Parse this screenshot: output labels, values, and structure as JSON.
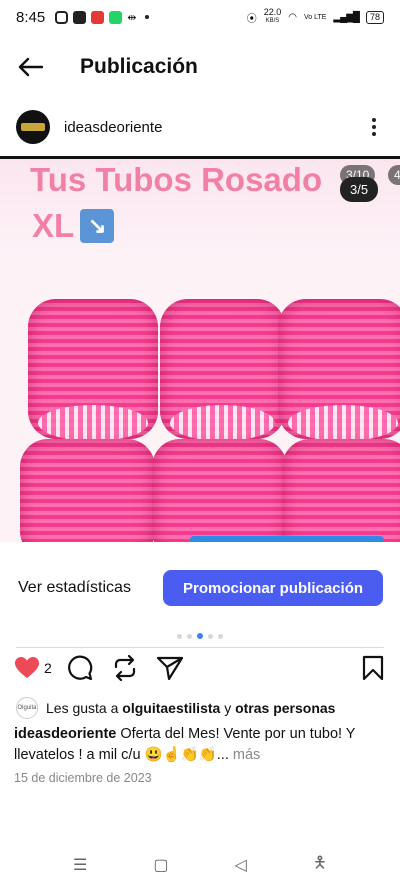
{
  "status_bar": {
    "time": "8:45",
    "app_icons": [
      "instagram-icon",
      "youtube-icon",
      "fs-icon",
      "whatsapp-icon",
      "sync-icon"
    ],
    "network_speed_value": "22.0",
    "network_speed_unit": "KB/S",
    "volte_label": "Vo LTE",
    "battery": "78"
  },
  "header": {
    "title": "Publicación"
  },
  "post": {
    "username": "ideasdeoriente",
    "media": {
      "text_line1": "Tus Tubos Rosado",
      "text_line2": "XL",
      "counter": "3/5",
      "counter_back": "3/10",
      "counter_back2": "4/"
    },
    "stats_label": "Ver estadísticas",
    "promote_label": "Promocionar publicación",
    "carousel_dots": 5,
    "carousel_active_index": 2,
    "like_count": "2",
    "likes_prefix": "Les gusta a",
    "likes_user": "olguitaestilista",
    "likes_suffix": "y",
    "likes_others": "otras personas",
    "caption_user": "ideasdeoriente",
    "caption_text": "Oferta del Mes! Vente  por un tubo! Y llevatelos ! a mil c/u 😃☝️👏👏...",
    "caption_more": "más",
    "date": "15 de diciembre de 2023"
  },
  "colors": {
    "accent": "#4a5df0",
    "like_red": "#ed4956",
    "pink_text": "#f27fa6"
  }
}
